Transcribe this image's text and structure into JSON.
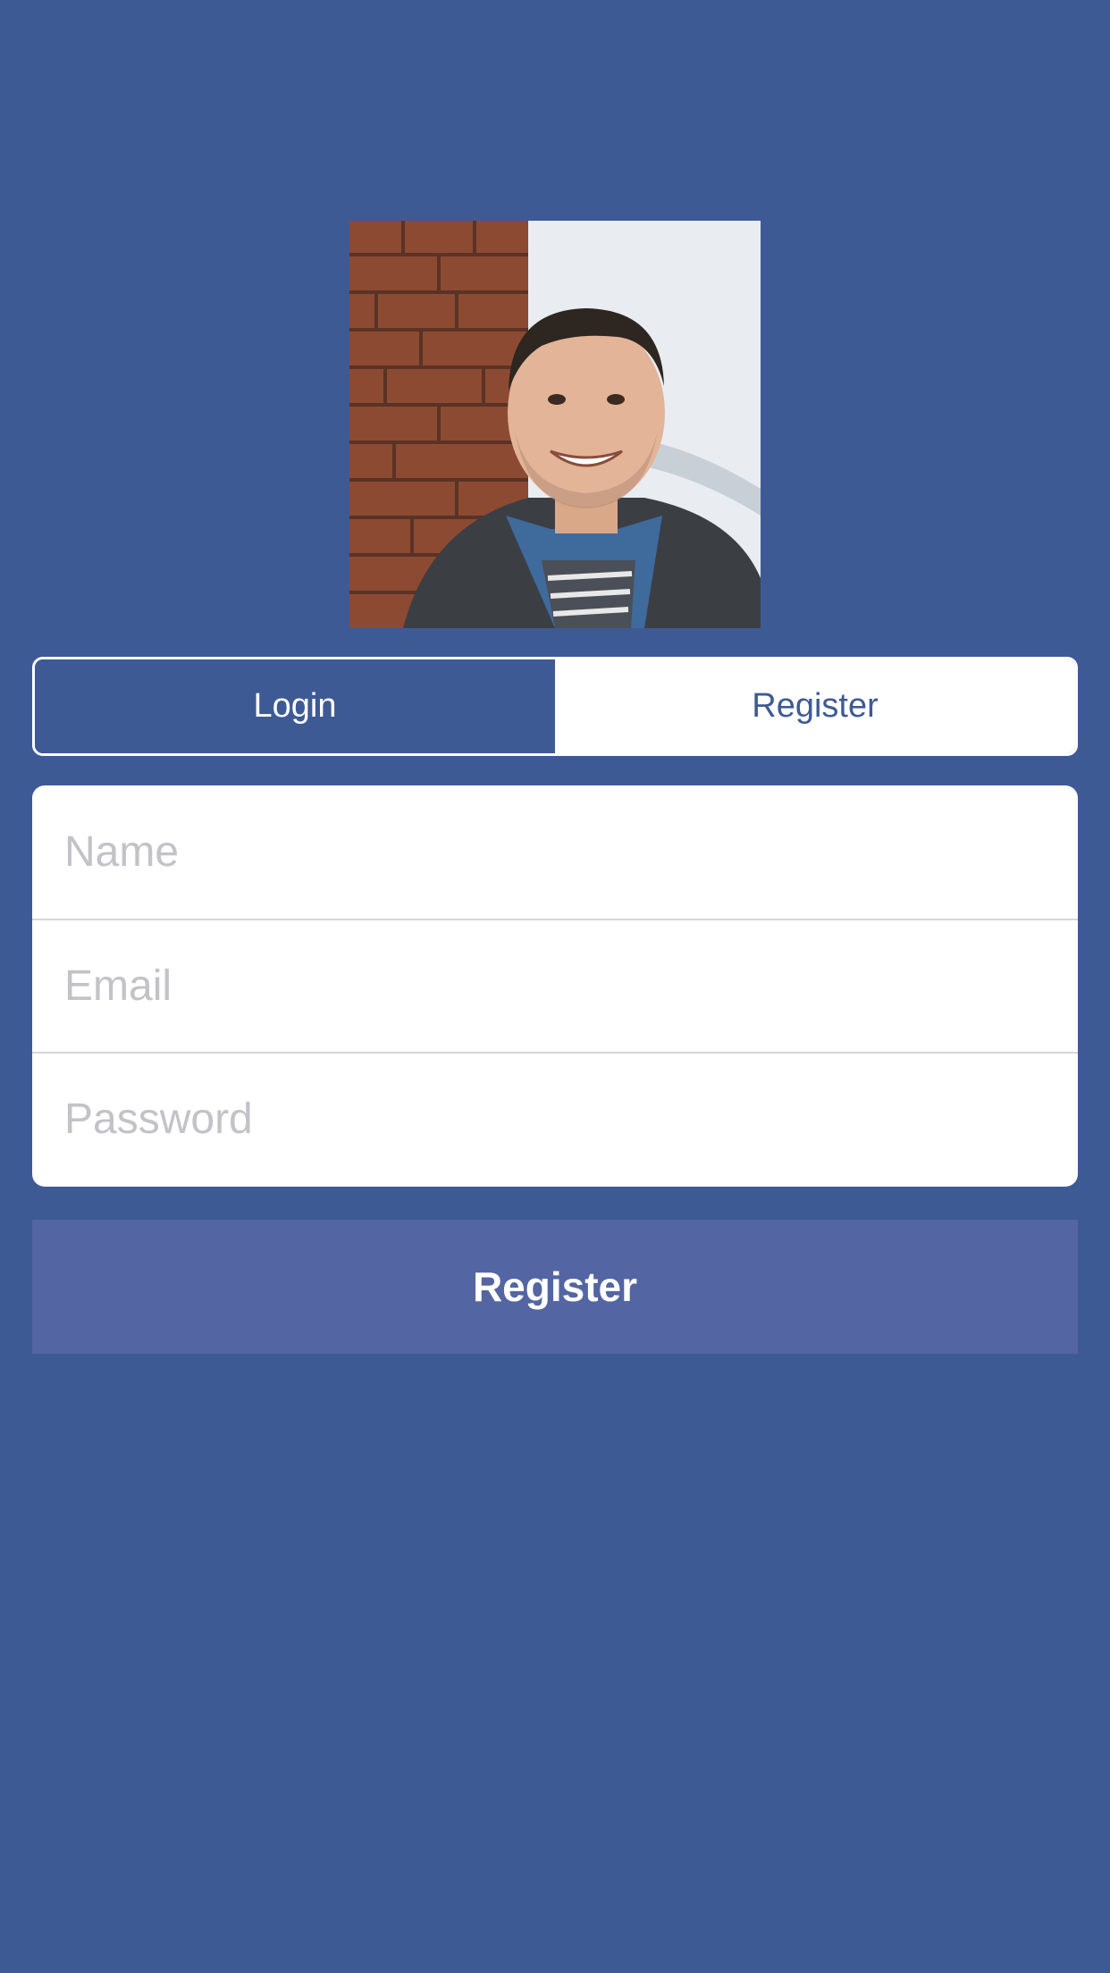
{
  "colors": {
    "background": "#3E5A95",
    "register_button": "#5365A2",
    "placeholder": "#C2C2C8"
  },
  "avatar": {
    "description_icon": "profile-photo"
  },
  "segmented": {
    "login_label": "Login",
    "register_label": "Register",
    "selected": "Login"
  },
  "form": {
    "name_placeholder": "Name",
    "email_placeholder": "Email",
    "password_placeholder": "Password"
  },
  "register_button_label": "Register"
}
